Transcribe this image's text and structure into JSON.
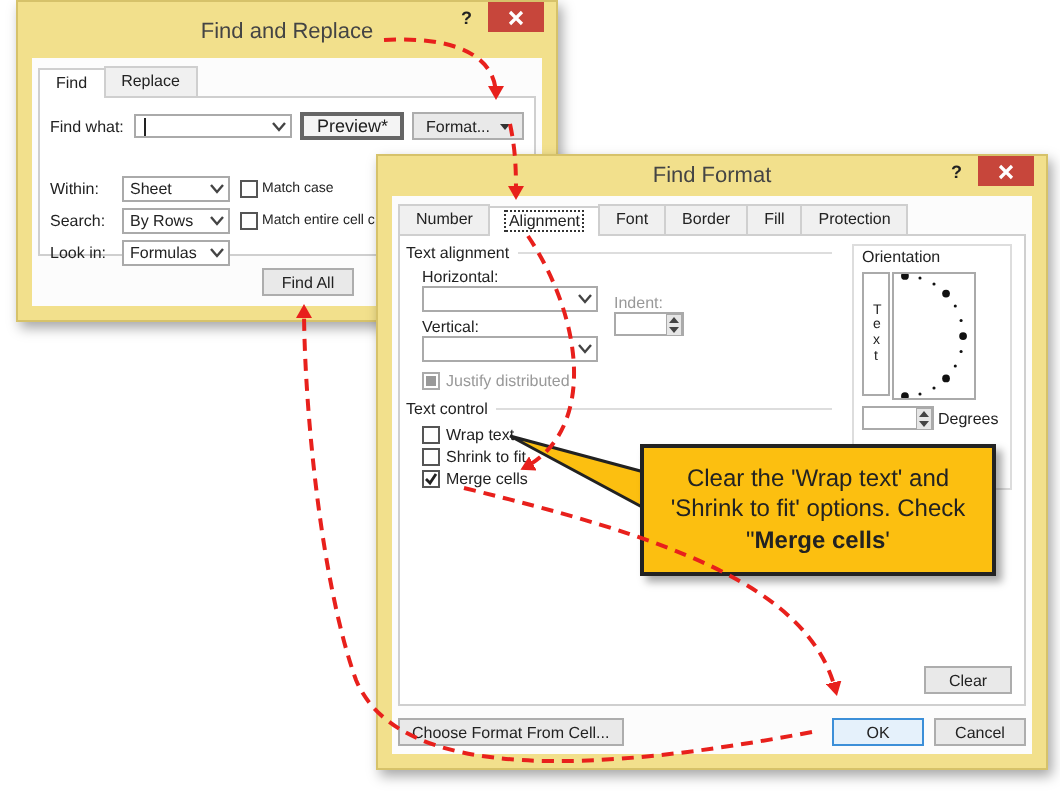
{
  "find_replace": {
    "title": "Find and Replace",
    "help": "?",
    "tabs": [
      {
        "label": "Find",
        "selected": true
      },
      {
        "label": "Replace",
        "selected": false
      }
    ],
    "find_what_label": "Find what:",
    "preview_button": "Preview*",
    "format_button": "Format...",
    "options": [
      {
        "label": "Within:",
        "value": "Sheet"
      },
      {
        "label": "Search:",
        "value": "By Rows"
      },
      {
        "label": "Look in:",
        "value": "Formulas"
      }
    ],
    "checkboxes": [
      {
        "label": "Match case",
        "checked": false
      },
      {
        "label": "Match entire cell c",
        "checked": false
      }
    ],
    "find_all_button": "Find All"
  },
  "find_format": {
    "title": "Find Format",
    "help": "?",
    "tabs": [
      {
        "label": "Number",
        "selected": false
      },
      {
        "label": "Alignment",
        "selected": true
      },
      {
        "label": "Font",
        "selected": false
      },
      {
        "label": "Border",
        "selected": false
      },
      {
        "label": "Fill",
        "selected": false
      },
      {
        "label": "Protection",
        "selected": false
      }
    ],
    "text_alignment": {
      "title": "Text alignment",
      "horizontal_label": "Horizontal:",
      "vertical_label": "Vertical:",
      "indent": {
        "label": "Indent:",
        "disabled": true
      },
      "justify": {
        "label": "Justify distributed",
        "disabled": true
      }
    },
    "text_control": {
      "title": "Text control",
      "checkboxes": [
        {
          "label": "Wrap text",
          "checked": false
        },
        {
          "label": "Shrink to fit",
          "checked": false
        },
        {
          "label": "Merge cells",
          "checked": true
        }
      ]
    },
    "orientation": {
      "title": "Orientation",
      "vertical_text": "Text",
      "degrees_label": "Degrees"
    },
    "clear_button": "Clear",
    "choose_button": "Choose Format From Cell...",
    "buttons": [
      {
        "label": "OK",
        "focused": true
      },
      {
        "label": "Cancel",
        "focused": false
      }
    ]
  },
  "callout": {
    "text": "Clear the 'Wrap text' and 'Shrink to fit' options. Check \"**Merge cells**'"
  }
}
